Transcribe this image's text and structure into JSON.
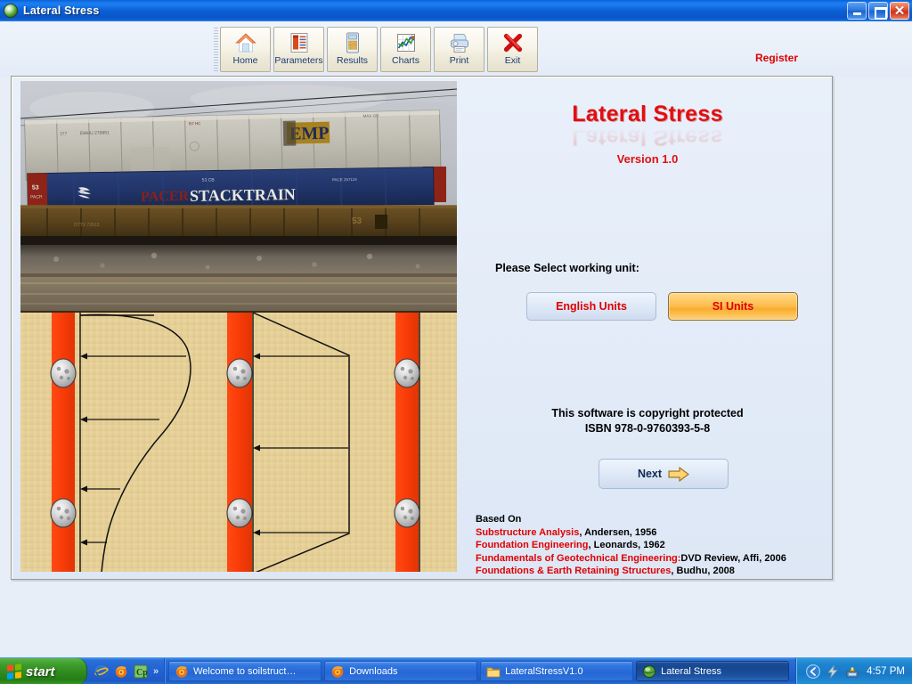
{
  "window": {
    "title": "Lateral Stress",
    "icon": "app-globe-icon",
    "controls": {
      "minimize": "Minimize",
      "maximize": "Maximize",
      "close": "Close"
    }
  },
  "toolbar": {
    "buttons": [
      {
        "label": "Home",
        "icon": "home-icon"
      },
      {
        "label": "Parameters",
        "icon": "parameters-list-icon"
      },
      {
        "label": "Results",
        "icon": "calculator-icon"
      },
      {
        "label": "Charts",
        "icon": "chart-icon"
      },
      {
        "label": "Print",
        "icon": "printer-icon"
      },
      {
        "label": "Exit",
        "icon": "red-x-icon"
      }
    ],
    "register_label": "Register",
    "register_color": "#e00000"
  },
  "main": {
    "photo_alt": "Photograph of a double-stack intermodal freight train with PACER STACKTRAIN container",
    "diagram_alt": "Lateral earth pressure diagram showing braced excavation struts with apparent pressure distributions",
    "logo": {
      "title": "Lateral Stress",
      "version": "Version 1.0",
      "color": "#e01010"
    },
    "unit_prompt": "Please Select working unit:",
    "unit_buttons": [
      {
        "label": "English Units",
        "selected": false
      },
      {
        "label": "SI Units",
        "selected": true
      }
    ],
    "selected_unit_color": "#f9ad2e",
    "copyright_line1": "This software is copyright protected",
    "copyright_line2": "ISBN 978-0-9760393-5-8",
    "next_label": "Next",
    "next_icon": "right-arrow-icon",
    "based_on_header": "Based On",
    "references": [
      {
        "title": "Substructure Analysis",
        "rest": ", Andersen, 1956"
      },
      {
        "title": "Foundation Engineering",
        "rest": ", Leonards, 1962"
      },
      {
        "title": "Fundamentals of Geotechnical Engineering:",
        "rest": "DVD Review, Affi, 2006"
      },
      {
        "title": "Foundations & Earth Retaining Structures",
        "rest": ", Budhu, 2008"
      }
    ]
  },
  "taskbar": {
    "start_label": "start",
    "quick_launch": [
      {
        "name": "internet-explorer-icon"
      },
      {
        "name": "firefox-icon"
      },
      {
        "name": "capture-cp-icon"
      }
    ],
    "quick_launch_more": "»",
    "tasks": [
      {
        "label": "Welcome to soilstruct…",
        "icon": "firefox-icon",
        "active": false
      },
      {
        "label": "Downloads",
        "icon": "firefox-icon",
        "active": false
      },
      {
        "label": "LateralStressV1.0",
        "icon": "folder-icon",
        "active": false
      },
      {
        "label": "Lateral Stress",
        "icon": "app-globe-icon",
        "active": true
      }
    ],
    "tray": [
      {
        "name": "show-hidden-icons-chevron"
      },
      {
        "name": "lightning-bolt-icon"
      },
      {
        "name": "network-activity-icon"
      }
    ],
    "clock": "4:57 PM"
  }
}
